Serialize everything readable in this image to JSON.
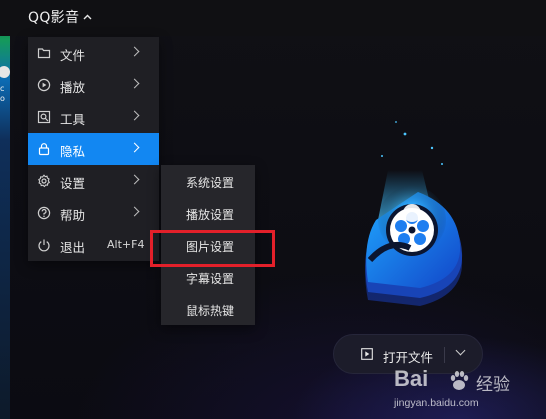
{
  "app": {
    "title": "QQ影音"
  },
  "menu": {
    "items": [
      {
        "label": "文件",
        "icon": "folder-icon",
        "has_submenu": true
      },
      {
        "label": "播放",
        "icon": "play-circle-icon",
        "has_submenu": true
      },
      {
        "label": "工具",
        "icon": "tools-icon",
        "has_submenu": true
      },
      {
        "label": "隐私",
        "icon": "lock-icon",
        "has_submenu": true,
        "active": true
      },
      {
        "label": "设置",
        "icon": "gear-icon",
        "has_submenu": true
      },
      {
        "label": "帮助",
        "icon": "help-icon",
        "has_submenu": true
      },
      {
        "label": "退出",
        "icon": "power-icon",
        "shortcut": "Alt+F4"
      }
    ]
  },
  "submenu": {
    "items": [
      {
        "label": "系统设置"
      },
      {
        "label": "播放设置"
      },
      {
        "label": "图片设置",
        "highlighted": true
      },
      {
        "label": "字幕设置"
      },
      {
        "label": "鼠标热键"
      }
    ]
  },
  "open_file": {
    "label": "打开文件"
  },
  "watermark": {
    "brand": "Bai",
    "brand_suffix": "经验",
    "url": "jingyan.baidu.com"
  },
  "left_strip": {
    "text": "c\no"
  },
  "colors": {
    "accent": "#1287f2",
    "highlight": "#e3202a",
    "background": "#0a0a12"
  }
}
